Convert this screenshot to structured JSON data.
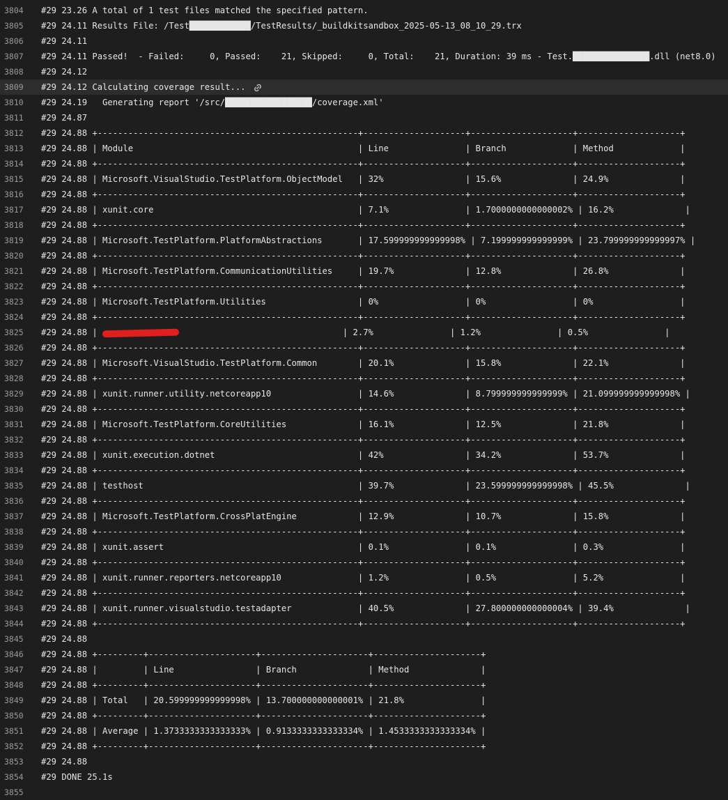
{
  "colors": {
    "background": "#1e1e1e",
    "text": "#e6e6e6",
    "line_number": "#9a9a9a",
    "highlight": "#2d2d2d",
    "redaction": "#e0201e"
  },
  "lines": [
    {
      "n": "3804",
      "t": "#29 23.26 A total of 1 test files matched the specified pattern."
    },
    {
      "n": "3805",
      "t": "#29 24.11 Results File: /Test████████████/TestResults/_buildkitsandbox_2025-05-13_08_10_29.trx"
    },
    {
      "n": "3806",
      "t": "#29 24.11"
    },
    {
      "n": "3807",
      "t": "#29 24.11 Passed!  - Failed:     0, Passed:    21, Skipped:     0, Total:    21, Duration: 39 ms - Test.███████████████.dll (net8.0)"
    },
    {
      "n": "3808",
      "t": "#29 24.12"
    },
    {
      "n": "3809",
      "t": "#29 24.12 Calculating coverage result...",
      "highlight": true,
      "link_icon": true
    },
    {
      "n": "3810",
      "t": "#29 24.19   Generating report '/src/█████████████████/coverage.xml'"
    },
    {
      "n": "3811",
      "t": "#29 24.87"
    },
    {
      "n": "3812",
      "t": "#29 24.88 +---------------------------------------------------+--------------------+--------------------+--------------------+"
    },
    {
      "n": "3813",
      "t": "#29 24.88 | Module                                            | Line               | Branch             | Method             |"
    },
    {
      "n": "3814",
      "t": "#29 24.88 +---------------------------------------------------+--------------------+--------------------+--------------------+"
    },
    {
      "n": "3815",
      "t": "#29 24.88 | Microsoft.VisualStudio.TestPlatform.ObjectModel   | 32%                | 15.6%              | 24.9%              |"
    },
    {
      "n": "3816",
      "t": "#29 24.88 +---------------------------------------------------+--------------------+--------------------+--------------------+"
    },
    {
      "n": "3817",
      "t": "#29 24.88 | xunit.core                                        | 7.1%               | 1.7000000000000002% | 16.2%              |"
    },
    {
      "n": "3818",
      "t": "#29 24.88 +---------------------------------------------------+--------------------+--------------------+--------------------+"
    },
    {
      "n": "3819",
      "t": "#29 24.88 | Microsoft.TestPlatform.PlatformAbstractions       | 17.599999999999998% | 7.199999999999999% | 23.799999999999997% |"
    },
    {
      "n": "3820",
      "t": "#29 24.88 +---------------------------------------------------+--------------------+--------------------+--------------------+"
    },
    {
      "n": "3821",
      "t": "#29 24.88 | Microsoft.TestPlatform.CommunicationUtilities     | 19.7%              | 12.8%              | 26.8%              |"
    },
    {
      "n": "3822",
      "t": "#29 24.88 +---------------------------------------------------+--------------------+--------------------+--------------------+"
    },
    {
      "n": "3823",
      "t": "#29 24.88 | Microsoft.TestPlatform.Utilities                  | 0%                 | 0%                 | 0%                 |"
    },
    {
      "n": "3824",
      "t": "#29 24.88 +---------------------------------------------------+--------------------+--------------------+--------------------+"
    },
    {
      "n": "3825",
      "t": "#29 24.88 | ",
      "redacted": true,
      "after": "                                | 2.7%               | 1.2%               | 0.5%               |"
    },
    {
      "n": "3826",
      "t": "#29 24.88 +---------------------------------------------------+--------------------+--------------------+--------------------+"
    },
    {
      "n": "3827",
      "t": "#29 24.88 | Microsoft.VisualStudio.TestPlatform.Common        | 20.1%              | 15.8%              | 22.1%              |"
    },
    {
      "n": "3828",
      "t": "#29 24.88 +---------------------------------------------------+--------------------+--------------------+--------------------+"
    },
    {
      "n": "3829",
      "t": "#29 24.88 | xunit.runner.utility.netcoreapp10                 | 14.6%              | 8.799999999999999% | 21.099999999999998% |"
    },
    {
      "n": "3830",
      "t": "#29 24.88 +---------------------------------------------------+--------------------+--------------------+--------------------+"
    },
    {
      "n": "3831",
      "t": "#29 24.88 | Microsoft.TestPlatform.CoreUtilities              | 16.1%              | 12.5%              | 21.8%              |"
    },
    {
      "n": "3832",
      "t": "#29 24.88 +---------------------------------------------------+--------------------+--------------------+--------------------+"
    },
    {
      "n": "3833",
      "t": "#29 24.88 | xunit.execution.dotnet                            | 42%                | 34.2%              | 53.7%              |"
    },
    {
      "n": "3834",
      "t": "#29 24.88 +---------------------------------------------------+--------------------+--------------------+--------------------+"
    },
    {
      "n": "3835",
      "t": "#29 24.88 | testhost                                          | 39.7%              | 23.599999999999998% | 45.5%              |"
    },
    {
      "n": "3836",
      "t": "#29 24.88 +---------------------------------------------------+--------------------+--------------------+--------------------+"
    },
    {
      "n": "3837",
      "t": "#29 24.88 | Microsoft.TestPlatform.CrossPlatEngine            | 12.9%              | 10.7%              | 15.8%              |"
    },
    {
      "n": "3838",
      "t": "#29 24.88 +---------------------------------------------------+--------------------+--------------------+--------------------+"
    },
    {
      "n": "3839",
      "t": "#29 24.88 | xunit.assert                                      | 0.1%               | 0.1%               | 0.3%               |"
    },
    {
      "n": "3840",
      "t": "#29 24.88 +---------------------------------------------------+--------------------+--------------------+--------------------+"
    },
    {
      "n": "3841",
      "t": "#29 24.88 | xunit.runner.reporters.netcoreapp10               | 1.2%               | 0.5%               | 5.2%               |"
    },
    {
      "n": "3842",
      "t": "#29 24.88 +---------------------------------------------------+--------------------+--------------------+--------------------+"
    },
    {
      "n": "3843",
      "t": "#29 24.88 | xunit.runner.visualstudio.testadapter             | 40.5%              | 27.800000000000004% | 39.4%              |"
    },
    {
      "n": "3844",
      "t": "#29 24.88 +---------------------------------------------------+--------------------+--------------------+--------------------+"
    },
    {
      "n": "3845",
      "t": "#29 24.88"
    },
    {
      "n": "3846",
      "t": "#29 24.88 +---------+---------------------+---------------------+---------------------+"
    },
    {
      "n": "3847",
      "t": "#29 24.88 |         | Line                | Branch              | Method              |"
    },
    {
      "n": "3848",
      "t": "#29 24.88 +---------+---------------------+---------------------+---------------------+"
    },
    {
      "n": "3849",
      "t": "#29 24.88 | Total   | 20.599999999999998% | 13.700000000000001% | 21.8%               |"
    },
    {
      "n": "3850",
      "t": "#29 24.88 +---------+---------------------+---------------------+---------------------+"
    },
    {
      "n": "3851",
      "t": "#29 24.88 | Average | 1.3733333333333333% | 0.9133333333333334% | 1.4533333333333334% |"
    },
    {
      "n": "3852",
      "t": "#29 24.88 +---------+---------------------+---------------------+---------------------+"
    },
    {
      "n": "3853",
      "t": "#29 24.88"
    },
    {
      "n": "3854",
      "t": "#29 DONE 25.1s"
    },
    {
      "n": "3855",
      "t": ""
    }
  ]
}
